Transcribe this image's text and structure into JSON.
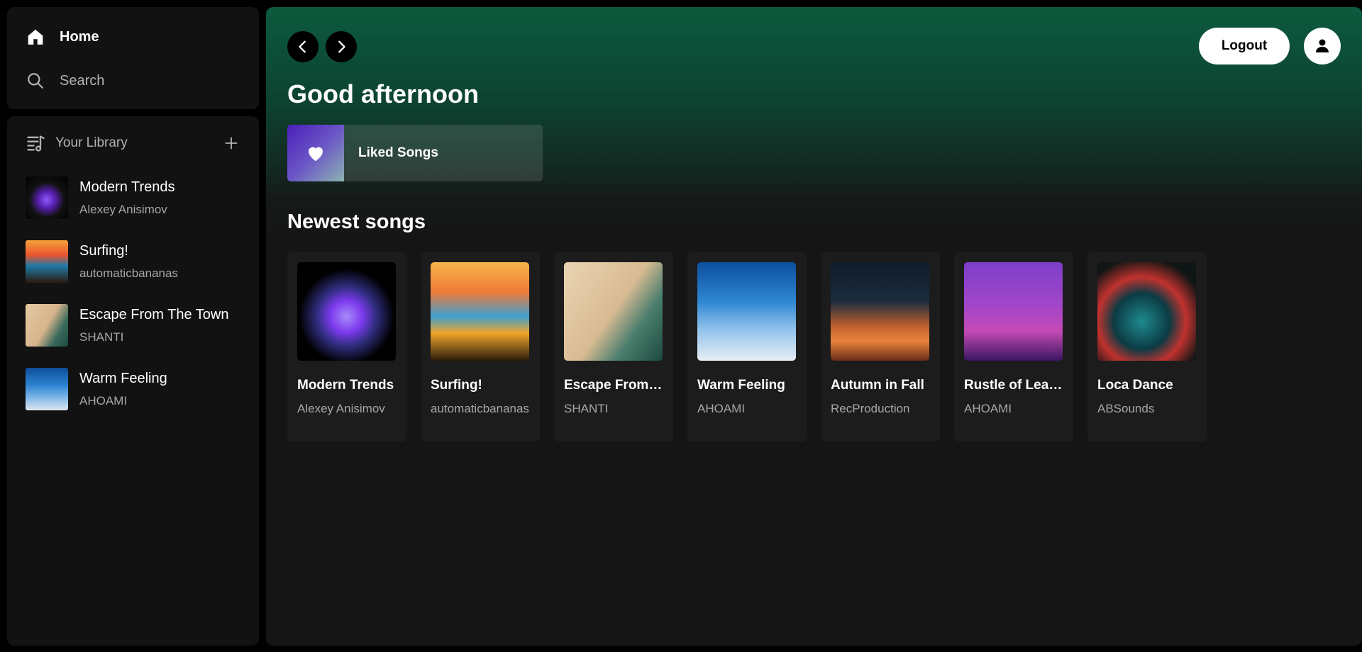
{
  "sidebar": {
    "nav": [
      {
        "label": "Home",
        "icon": "home-icon"
      },
      {
        "label": "Search",
        "icon": "search-icon"
      }
    ],
    "library": {
      "label": "Your Library",
      "icon": "library-icon",
      "add_icon": "plus-icon",
      "items": [
        {
          "title": "Modern Trends",
          "artist": "Alexey Anisimov"
        },
        {
          "title": "Surfing!",
          "artist": "automaticbananas"
        },
        {
          "title": "Escape From The Town",
          "artist": "SHANTI"
        },
        {
          "title": "Warm Feeling",
          "artist": "AHOAMI"
        }
      ]
    }
  },
  "header": {
    "back_icon": "chevron-left-icon",
    "forward_icon": "chevron-right-icon",
    "logout_label": "Logout",
    "avatar_icon": "user-icon"
  },
  "main": {
    "greeting": "Good afternoon",
    "liked_songs": {
      "label": "Liked Songs",
      "icon": "heart-icon"
    },
    "newest_title": "Newest songs",
    "songs": [
      {
        "title": "Modern Trends",
        "artist": "Alexey Anisimov"
      },
      {
        "title": "Surfing!",
        "artist": "automaticbananas"
      },
      {
        "title": "Escape From The Town",
        "artist": "SHANTI"
      },
      {
        "title": "Warm Feeling",
        "artist": "AHOAMI"
      },
      {
        "title": "Autumn in Fall",
        "artist": "RecProduction"
      },
      {
        "title": "Rustle of Leaves",
        "artist": "AHOAMI"
      },
      {
        "title": "Loca Dance",
        "artist": "ABSounds"
      }
    ]
  },
  "colors": {
    "accent_green": "#0c5a3e",
    "sidebar_bg": "#121212",
    "card_bg": "#1c1c1c"
  }
}
